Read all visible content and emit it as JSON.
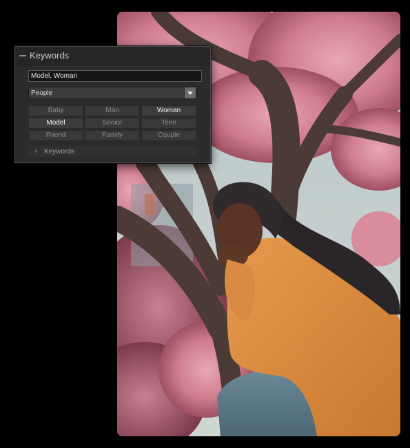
{
  "panel": {
    "title": "Keywords",
    "keyword_field_value": "Model, Woman",
    "keyword_set": "People",
    "keyword_buttons": [
      {
        "label": "Baby",
        "active": false
      },
      {
        "label": "Man",
        "active": false
      },
      {
        "label": "Woman",
        "active": true
      },
      {
        "label": "Model",
        "active": true
      },
      {
        "label": "Senior",
        "active": false
      },
      {
        "label": "Teen",
        "active": false
      },
      {
        "label": "Friend",
        "active": false
      },
      {
        "label": "Family",
        "active": false
      },
      {
        "label": "Couple",
        "active": false
      }
    ],
    "subsection_label": "Keywords",
    "icons": {
      "collapse": "minus-icon",
      "dropdown": "chevron-down-icon",
      "expand": "plus-icon"
    }
  },
  "colors": {
    "panel_bg": "#2b2b2b",
    "button_active_text": "#f2f2f2",
    "button_inactive_text": "#8b8b8b",
    "page_bg": "#000000"
  }
}
